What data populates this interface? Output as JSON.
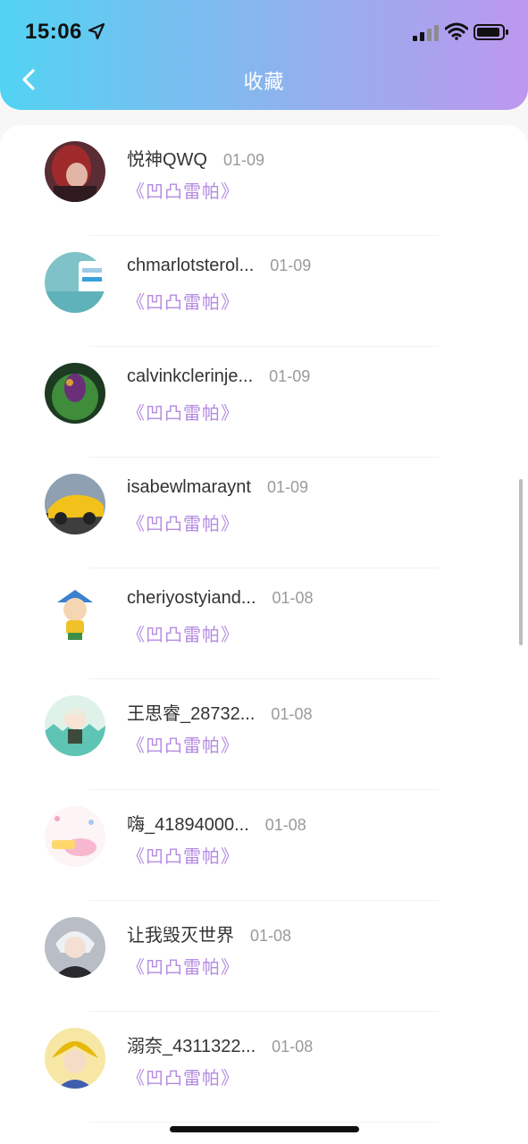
{
  "status_bar": {
    "time": "15:06"
  },
  "header": {
    "title": "收藏"
  },
  "items": [
    {
      "name": "悦神QWQ",
      "date": "01-09",
      "book": "《凹凸雷帕》"
    },
    {
      "name": "chmarlotsterol...",
      "date": "01-09",
      "book": "《凹凸雷帕》"
    },
    {
      "name": "calvinkclerinje...",
      "date": "01-09",
      "book": "《凹凸雷帕》"
    },
    {
      "name": "isabewlmaraynt",
      "date": "01-09",
      "book": "《凹凸雷帕》"
    },
    {
      "name": "cheriyostyiand...",
      "date": "01-08",
      "book": "《凹凸雷帕》"
    },
    {
      "name": "王思睿_28732...",
      "date": "01-08",
      "book": "《凹凸雷帕》"
    },
    {
      "name": "嗨_41894000...",
      "date": "01-08",
      "book": "《凹凸雷帕》"
    },
    {
      "name": "让我毁灭世界",
      "date": "01-08",
      "book": "《凹凸雷帕》"
    },
    {
      "name": "溺奈_4311322...",
      "date": "01-08",
      "book": "《凹凸雷帕》"
    }
  ],
  "colors": {
    "accent": "#b58be2",
    "header_start": "#52d3f3",
    "header_end": "#bd97ee"
  }
}
